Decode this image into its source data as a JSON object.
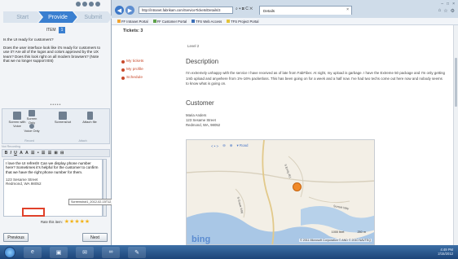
{
  "feedback_panel": {
    "steps": [
      "Start",
      "Provide",
      "Submit"
    ],
    "item_label": "ITEM",
    "item_number": "1",
    "questions": [
      "Is the UI ready for customers?",
      "Does the user interface look like it's ready for customers to use it? Are all of the logos and colors approved by the UX team? Does this look right on all modern browsers? (Note that we no longer support IE6)"
    ],
    "handle": "•••••",
    "tools": [
      {
        "label": "Screen with Voice",
        "icon": "screen-voice-icon"
      },
      {
        "label": "Screen Only",
        "icon": "screen-only-icon"
      },
      {
        "label": "Voice Only",
        "icon": "voice-icon"
      },
      {
        "label": "Screenshot",
        "icon": "screenshot-icon"
      },
      {
        "label": "Attach file",
        "icon": "attach-file-icon"
      }
    ],
    "tools_captions": [
      "Record",
      "Attach"
    ],
    "toolbar_caption": "Not Recording",
    "format_buttons": [
      "B",
      "I",
      "U",
      "A",
      "A",
      "☰",
      "•",
      "☰",
      "☰",
      "⊞",
      "⊟"
    ],
    "editor": {
      "text": "I love the UI refresh! Can we display phone number here? Sometimes it's helpful for the customer to confirm that we have the right phone number for them.",
      "address_line1": "123 Sesame Street",
      "address_line2": "Redmond, WA 98052"
    },
    "tooltip": "Screenshot1_2012-02-15T12_48_20.png",
    "rate_label": "Rate this item:",
    "rating": 5,
    "rating_max": 5,
    "previous_label": "Previous",
    "next_label": "Next"
  },
  "browser": {
    "address_url": "http://intranet.fabrikam.com/ServiceTickets/Details/3",
    "address_controls": "⌕ ▾ ⊠ C ✕",
    "tab_title": "Details",
    "tab_close": "×",
    "window_buttons": [
      "–",
      "□",
      "×"
    ],
    "right_icons": [
      "⌂",
      "☆",
      "⚙"
    ],
    "favorites": [
      {
        "label": "FF Intranet Portal",
        "color": "#f3a32d"
      },
      {
        "label": "FF Customer Portal",
        "color": "#5fa24a"
      },
      {
        "label": "TFS Web Access",
        "color": "#3c6fb8"
      },
      {
        "label": "TFS Project Portal",
        "color": "#e3c23a"
      }
    ]
  },
  "page": {
    "tickets_label": "Tickets: 3",
    "level": "Level 2",
    "side_links": [
      "My tickets",
      "My profile",
      "Schedule"
    ],
    "description_heading": "Description",
    "description_text": "I'm extremely unhappy with the service I have received as of late from FabFiber. At night, my upload is garbage. I have the Extreme 50 package and I'm only getting 1mb upload and anywhere from 1%-16% packetloss. This has been going on for a week and a half now. I've had two techs come out here now and nobody seems to know what is going on.",
    "customer_heading": "Customer",
    "customer_name": "Maria Anders",
    "customer_street": "123 Sesame Street",
    "customer_city": "Redmond, WA, 98052"
  },
  "map": {
    "controls": [
      "< • >",
      "⊖",
      "⊕"
    ],
    "road_label": "▾ Road",
    "street_labels": [
      "S Emily Rd",
      "S Grove Way",
      "Sunset Way"
    ],
    "brand": "bing",
    "scale": [
      "1000 feet",
      "250 m"
    ],
    "copyright": "© 2011 Microsoft Corporation  © AND  © 2010 NAVTEQ"
  },
  "taskbar": {
    "items": [
      "e",
      "▣",
      "✉",
      "∞",
      "✎"
    ],
    "clock_time": "4:49 PM",
    "clock_date": "2/15/2012"
  }
}
